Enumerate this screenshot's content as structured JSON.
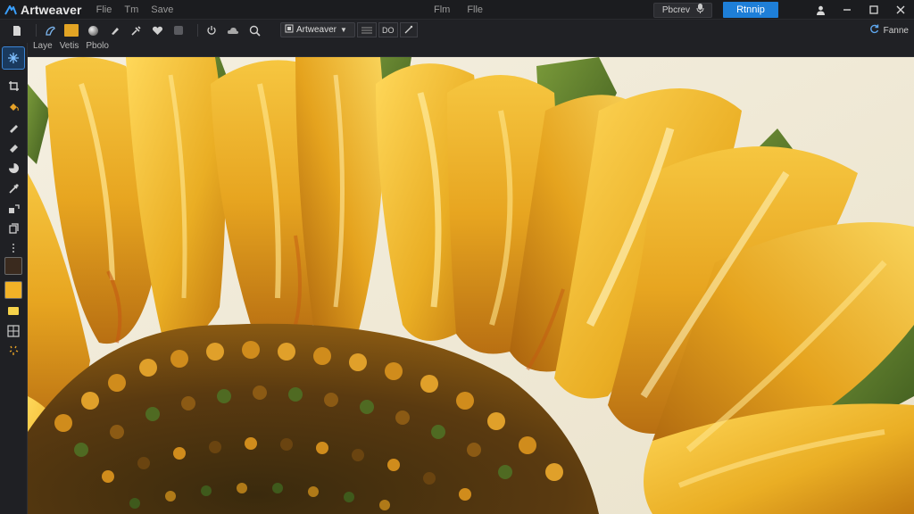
{
  "titlebar": {
    "app_name": "Artweaver",
    "menu_left": [
      "Flie",
      "Tm",
      "Save"
    ],
    "menu_center": [
      "Flm",
      "Flle"
    ],
    "preview_label": "Pbcrev",
    "primary_label": "Rtnnip"
  },
  "optionsbar": {
    "tool_labels": [
      "Laye",
      "Vetis",
      "Pbolo"
    ],
    "preset_value": "Artweaver",
    "option_values": [
      "",
      "DO"
    ],
    "frame_label": "Fanne"
  },
  "colors": {
    "accent": "#1e7fd8",
    "foreground_swatch": "#3a2a1e",
    "background_swatch": "#f2b227",
    "small_swatch": "#f5d24a"
  },
  "icons": {
    "title_logo": "artweaver-logo-icon",
    "preview": "microphone-icon",
    "options_row": [
      "page-icon",
      "brush-icon",
      "image-swatch",
      "sphere-icon",
      "pen-icon",
      "dropper-icon",
      "heart-icon",
      "square-icon",
      "power-icon",
      "cloud-icon",
      "search-icon"
    ],
    "left_tools": [
      "sparkle-move-icon",
      "crop-icon",
      "bucket-icon",
      "pencil-icon",
      "pie-icon",
      "eyedropper-icon",
      "transform-icon",
      "layers-icon",
      "more-icon"
    ]
  },
  "canvas": {
    "subject": "impasto-sunflower-painting"
  }
}
